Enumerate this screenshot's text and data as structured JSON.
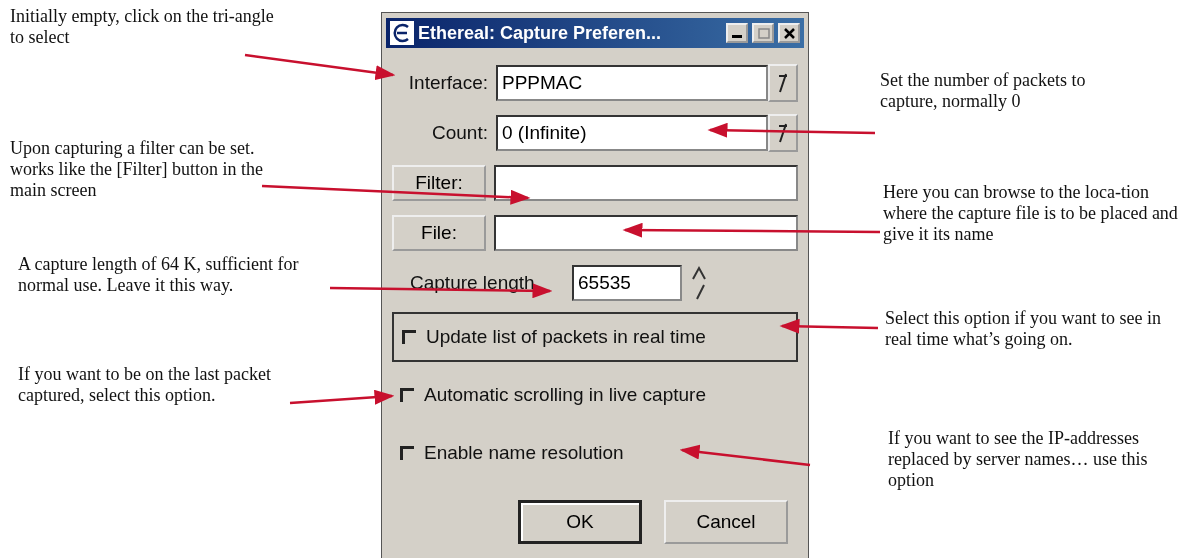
{
  "window": {
    "title": "Ethereal: Capture Preferen..."
  },
  "fields": [
    {
      "kind": "combo",
      "label": "Interface:",
      "value": "PPPMAC"
    },
    {
      "kind": "combo",
      "label": "Count:",
      "value": "0 (Infinite)"
    },
    {
      "kind": "browse",
      "label": "Filter:"
    },
    {
      "kind": "browse",
      "label": "File:"
    },
    {
      "kind": "spin",
      "label": "Capture length",
      "value": "65535"
    }
  ],
  "checkboxes": [
    {
      "label": "Update list of packets in real time",
      "checked": false,
      "focused": true
    },
    {
      "label": "Automatic scrolling in live capture",
      "checked": false,
      "focused": false
    },
    {
      "label": "Enable name resolution",
      "checked": false,
      "focused": false
    }
  ],
  "buttons": [
    {
      "label": "OK",
      "default": true
    },
    {
      "label": "Cancel",
      "default": false
    }
  ],
  "annotations": [
    {
      "text": "Initially empty, click on the tri-angle to select"
    },
    {
      "text": "Upon capturing a filter can be set. works like the [Filter] button in the main screen"
    },
    {
      "text": "A capture length of 64 K, sufficient for normal use. Leave it this way."
    },
    {
      "text": "If you want to be on the last packet captured, select this option."
    },
    {
      "text": "Set the number of packets to capture, normally 0"
    },
    {
      "text": "Here you can browse to the loca-tion where the capture file is to be placed and give it its name"
    },
    {
      "text": "Select this option if you want to see in real time what’s going on."
    },
    {
      "text": "If you want to see the IP-addresses replaced by server names… use this option"
    }
  ]
}
